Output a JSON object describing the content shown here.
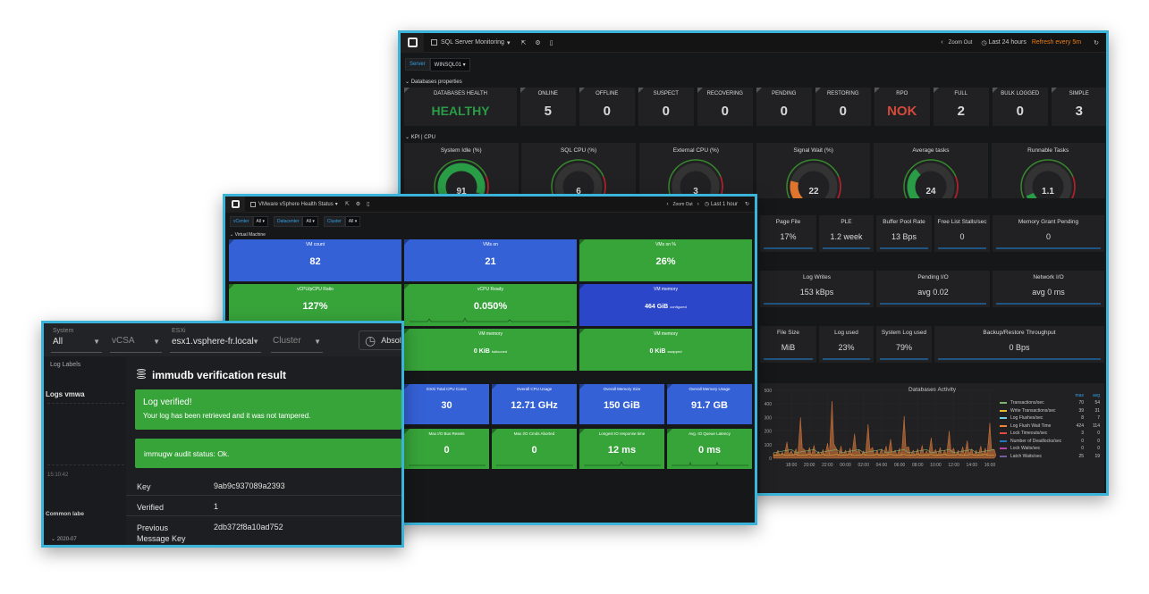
{
  "sql": {
    "title": "SQL Server Monitoring",
    "zoom_out": "Zoom Out",
    "time_range": "Last 24 hours",
    "refresh": "Refresh every 5m",
    "var_label": "Server",
    "var_value": "WINSQL01",
    "row1": "Databases properties",
    "row2": "KPI | CPU",
    "stats": [
      {
        "label": "DATABASES HEALTH",
        "value": "HEALTHY",
        "color": "#299c46"
      },
      {
        "label": "ONLINE",
        "value": "5",
        "color": "#d8d9da"
      },
      {
        "label": "OFFLINE",
        "value": "0",
        "color": "#d8d9da"
      },
      {
        "label": "SUSPECT",
        "value": "0",
        "color": "#d8d9da"
      },
      {
        "label": "RECOVERING",
        "value": "0",
        "color": "#d8d9da"
      },
      {
        "label": "PENDING",
        "value": "0",
        "color": "#d8d9da"
      },
      {
        "label": "RESTORING",
        "value": "0",
        "color": "#d8d9da"
      },
      {
        "label": "RPO",
        "value": "NOK",
        "color": "#d44a3a"
      },
      {
        "label": "FULL",
        "value": "2",
        "color": "#d8d9da"
      },
      {
        "label": "BULK LOGGED",
        "value": "0",
        "color": "#d8d9da"
      },
      {
        "label": "SIMPLE",
        "value": "3",
        "color": "#d8d9da"
      }
    ],
    "gauges": [
      {
        "label": "System Idle (%)",
        "value": "91",
        "fill": 0.91,
        "color": "#299c46"
      },
      {
        "label": "SQL CPU (%)",
        "value": "6",
        "fill": 0.06,
        "color": "#299c46"
      },
      {
        "label": "External CPU (%)",
        "value": "3",
        "fill": 0.03,
        "color": "#299c46"
      },
      {
        "label": "Signal Wait (%)",
        "value": "22",
        "fill": 0.22,
        "color": "#e0752d"
      },
      {
        "label": "Average tasks",
        "value": "24",
        "fill": 0.35,
        "color": "#299c46"
      },
      {
        "label": "Runnable Tasks",
        "value": "1.1",
        "fill": 0.08,
        "color": "#299c46"
      }
    ],
    "mem_row": [
      {
        "label": "Page File",
        "value": "17%"
      },
      {
        "label": "PLE",
        "value": "1.2 week"
      },
      {
        "label": "Buffer Pool Rate",
        "value": "13 Bps"
      },
      {
        "label": "Free List Stalls/sec",
        "value": "0"
      },
      {
        "label": "Memory Grant Pending",
        "value": "0"
      }
    ],
    "io_row": [
      {
        "label": "Log Writes",
        "value": "153 kBps"
      },
      {
        "label": "Pending I/O",
        "value": "avg   0.02"
      },
      {
        "label": "Network I/O",
        "value": "avg   0 ms"
      }
    ],
    "log_row": [
      {
        "label": "File Size",
        "value": "MiB"
      },
      {
        "label": "Log used",
        "value": "23%"
      },
      {
        "label": "System Log used",
        "value": "79%"
      },
      {
        "label": "Backup/Restore Throughput",
        "value": "0 Bps"
      }
    ],
    "chart_data": {
      "type": "line",
      "title": "Databases Activity",
      "x": [
        "18:00",
        "20:00",
        "22:00",
        "00:00",
        "02:00",
        "04:00",
        "06:00",
        "08:00",
        "10:00",
        "12:00",
        "14:00",
        "16:00"
      ],
      "y_ticks": [
        "0",
        "100",
        "200",
        "300",
        "400",
        "500"
      ],
      "visible_y_fragment": "500",
      "ylim": [
        0,
        500
      ],
      "legend_headers": {
        "max": "max",
        "avg": "avg"
      },
      "series": [
        {
          "name": "Transactions/sec",
          "max": "70",
          "avg": "54",
          "color": "#7eb26d"
        },
        {
          "name": "Write Transactions/sec",
          "max": "39",
          "avg": "31",
          "color": "#eab839"
        },
        {
          "name": "Log Flushes/sec",
          "max": "8",
          "avg": "7",
          "color": "#6ed0e0"
        },
        {
          "name": "Log Flush Wait Time",
          "max": "424",
          "avg": "114",
          "color": "#ef843c"
        },
        {
          "name": "Lock Timeouts/sec",
          "max": "3",
          "avg": "0",
          "color": "#e24d42"
        },
        {
          "name": "Number of Deadlocks/sec",
          "max": "0",
          "avg": "0",
          "color": "#1f78c1"
        },
        {
          "name": "Lock Waits/sec",
          "max": "0",
          "avg": "0",
          "color": "#ba43a9"
        },
        {
          "name": "Latch Waits/sec",
          "max": "25",
          "avg": "19",
          "color": "#705da0"
        }
      ],
      "peak_series": [
        40,
        60,
        45,
        120,
        55,
        70,
        300,
        60,
        80,
        95,
        50,
        65,
        110,
        420,
        70,
        90,
        60,
        75,
        180,
        65,
        55,
        250,
        80,
        60,
        70,
        90,
        140,
        60,
        75,
        310,
        85,
        60,
        70,
        95,
        55,
        150,
        65,
        80,
        60,
        200,
        75,
        60,
        85,
        130,
        70,
        60,
        90,
        75,
        260,
        65
      ]
    }
  },
  "vsphere": {
    "title": "VMware vSphere Health Status",
    "zoom_out": "Zoom Out",
    "time_range": "Last 1 hour",
    "vars": [
      {
        "label": "vCenter",
        "value": "All"
      },
      {
        "label": "Datacenter",
        "value": "All"
      },
      {
        "label": "Cluster",
        "value": "All"
      }
    ],
    "row_title": "Virtual Machine",
    "panels": [
      {
        "label": "VM count",
        "value": "82",
        "suffix": "",
        "color": "#3561d6"
      },
      {
        "label": "VMs on",
        "value": "21",
        "suffix": "",
        "color": "#3561d6"
      },
      {
        "label": "VMs on %",
        "value": "26%",
        "suffix": "",
        "color": "#37a43a"
      },
      {
        "label": "vCPU/pCPU Ratio",
        "value": "127%",
        "suffix": "",
        "color": "#37a43a"
      },
      {
        "label": "vCPU Ready",
        "value": "0.050%",
        "suffix": "",
        "color": "#37a43a"
      },
      {
        "label": "VM memory",
        "value": "464 GiB",
        "suffix": "configured",
        "color": "#2c46c9"
      },
      {
        "label": "",
        "value": "",
        "suffix": "",
        "color": "#37a43a"
      },
      {
        "label": "VM memory",
        "value": "0 KiB",
        "suffix": "ballooned",
        "color": "#37a43a"
      },
      {
        "label": "VM memory",
        "value": "0 KiB",
        "suffix": "swapped",
        "color": "#37a43a"
      }
    ],
    "esx_panels": [
      {
        "label": "ESXi Total CPU Cores",
        "value": "30",
        "color": "#3561d6"
      },
      {
        "label": "Overall CPU Usage",
        "value": "12.71 GHz",
        "color": "#3561d6"
      },
      {
        "label": "Overall Memory Size",
        "value": "150 GiB",
        "color": "#3561d6"
      },
      {
        "label": "Overall Memory Usage",
        "value": "91.7 GB",
        "color": "#3561d6"
      },
      {
        "label": "Max I/O Bus Resets",
        "value": "0",
        "color": "#37a43a"
      },
      {
        "label": "Max I/O Cmds Aborted",
        "value": "0",
        "color": "#37a43a"
      },
      {
        "label": "Longest IO response time",
        "value": "12 ms",
        "color": "#37a43a"
      },
      {
        "label": "Avg. IO Queue Latency",
        "value": "0 ms",
        "color": "#37a43a"
      }
    ]
  },
  "immudb": {
    "filters": [
      {
        "label": "System",
        "value": "All"
      },
      {
        "label": "",
        "value": "vCSA"
      },
      {
        "label": "ESXi",
        "value": "esx1.vsphere-fr.local"
      },
      {
        "label": "",
        "value": "Cluster"
      }
    ],
    "absolute_btn": "Absolu",
    "sidebar_log_labels": "Log Labels",
    "sidebar_logs": "Logs vmwa",
    "sidebar_time": "15:10:42",
    "sidebar_common": "Common labe",
    "sidebar_date": "2020-07",
    "dialog_title": "immudb verification result",
    "success_title": "Log verified!",
    "success_text": "Your log has been retrieved and it was not tampered.",
    "audit_status": "immugw audit status: Ok.",
    "rows": [
      {
        "key": "Key",
        "value": "9ab9c937089a2393"
      },
      {
        "key": "Verified",
        "value": "1"
      },
      {
        "key": "Previous Message Key",
        "value": "2db372f8a10ad752"
      }
    ]
  }
}
